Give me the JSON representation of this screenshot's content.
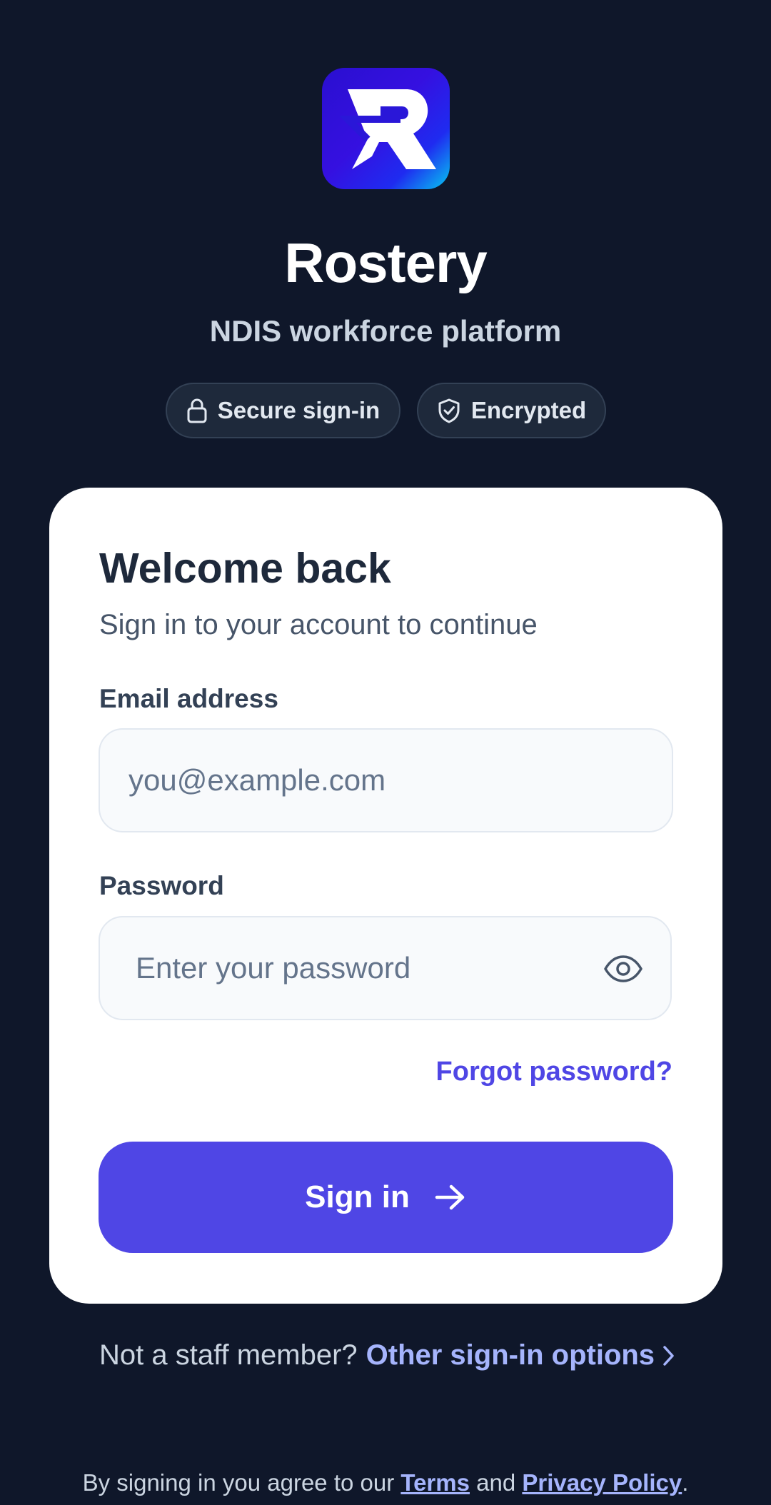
{
  "app": {
    "title": "Rostery",
    "subtitle": "NDIS workforce platform",
    "logo_icon": "rostery-logo-icon"
  },
  "chips": {
    "secure": "Secure sign-in",
    "encrypted": "Encrypted"
  },
  "card": {
    "title": "Welcome back",
    "subtitle": "Sign in to your account to continue",
    "email": {
      "label": "Email address",
      "value": "",
      "placeholder": "you@example.com"
    },
    "password": {
      "label": "Password",
      "value": "",
      "placeholder": "Enter your password",
      "toggle_icon": "eye-icon"
    },
    "forgot_label": "Forgot password?",
    "signin_label": "Sign in"
  },
  "alt": {
    "prompt": "Not a staff member?",
    "link": "Other sign-in options"
  },
  "footer": {
    "prefix": "By signing in you agree to our ",
    "terms": "Terms",
    "middle": " and ",
    "privacy": "Privacy Policy",
    "suffix": "."
  },
  "colors": {
    "background": "#0f172a",
    "card": "#ffffff",
    "accent": "#4f46e5",
    "link_light": "#a5b4fc"
  }
}
